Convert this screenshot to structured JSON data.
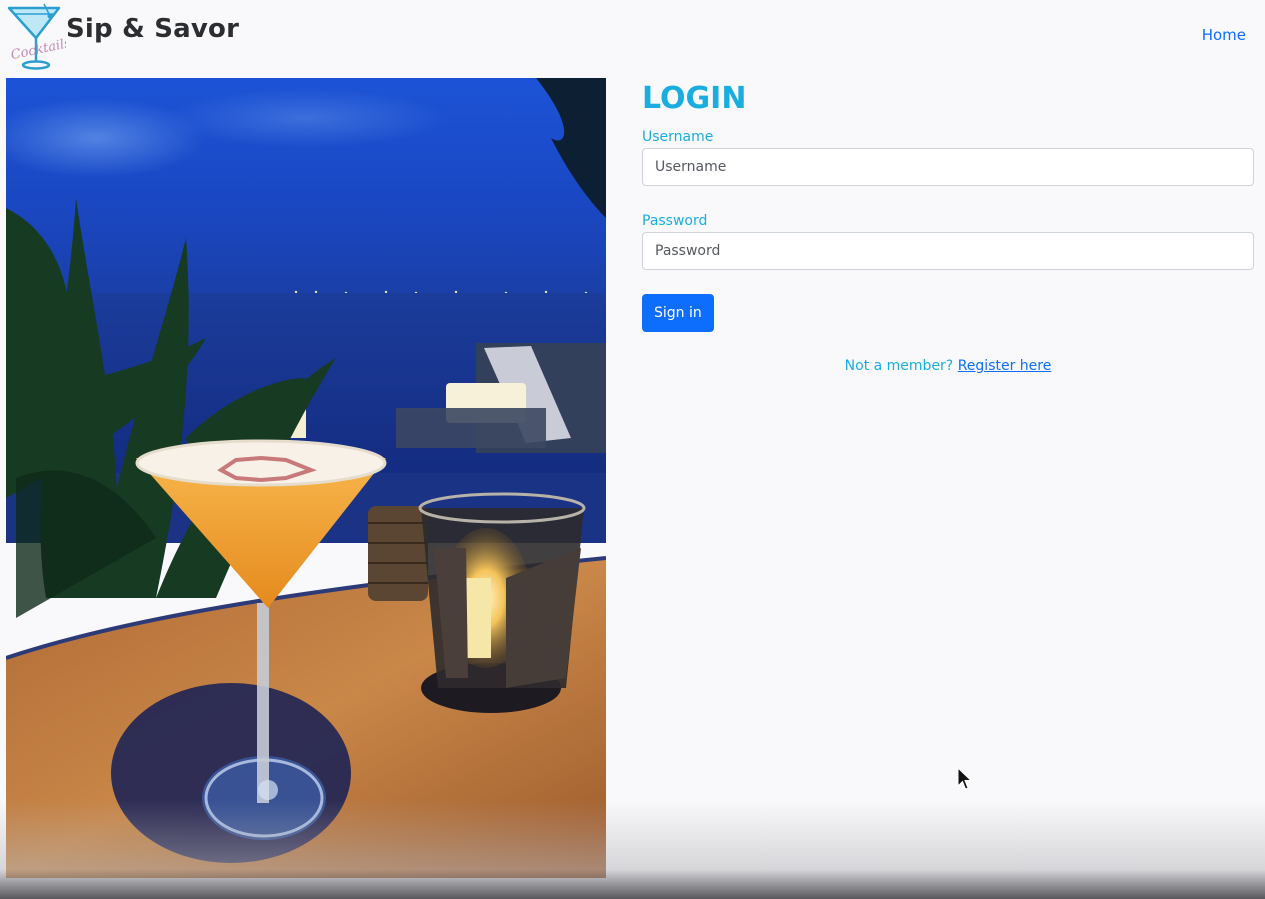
{
  "header": {
    "logo_script": "Cocktails",
    "brand": "Sip & Savor",
    "nav_home": "Home"
  },
  "hero": {
    "description": "cocktail-photo"
  },
  "login": {
    "title": "LOGIN",
    "username_label": "Username",
    "username_placeholder": "Username",
    "username_value": "",
    "password_label": "Password",
    "password_placeholder": "Password",
    "password_value": "",
    "signin_label": "Sign in",
    "register_prompt": "Not a member?",
    "register_link": "Register here"
  },
  "colors": {
    "accent": "#1aaee0",
    "primary": "#0d6efd",
    "background": "#f9f9fb"
  }
}
